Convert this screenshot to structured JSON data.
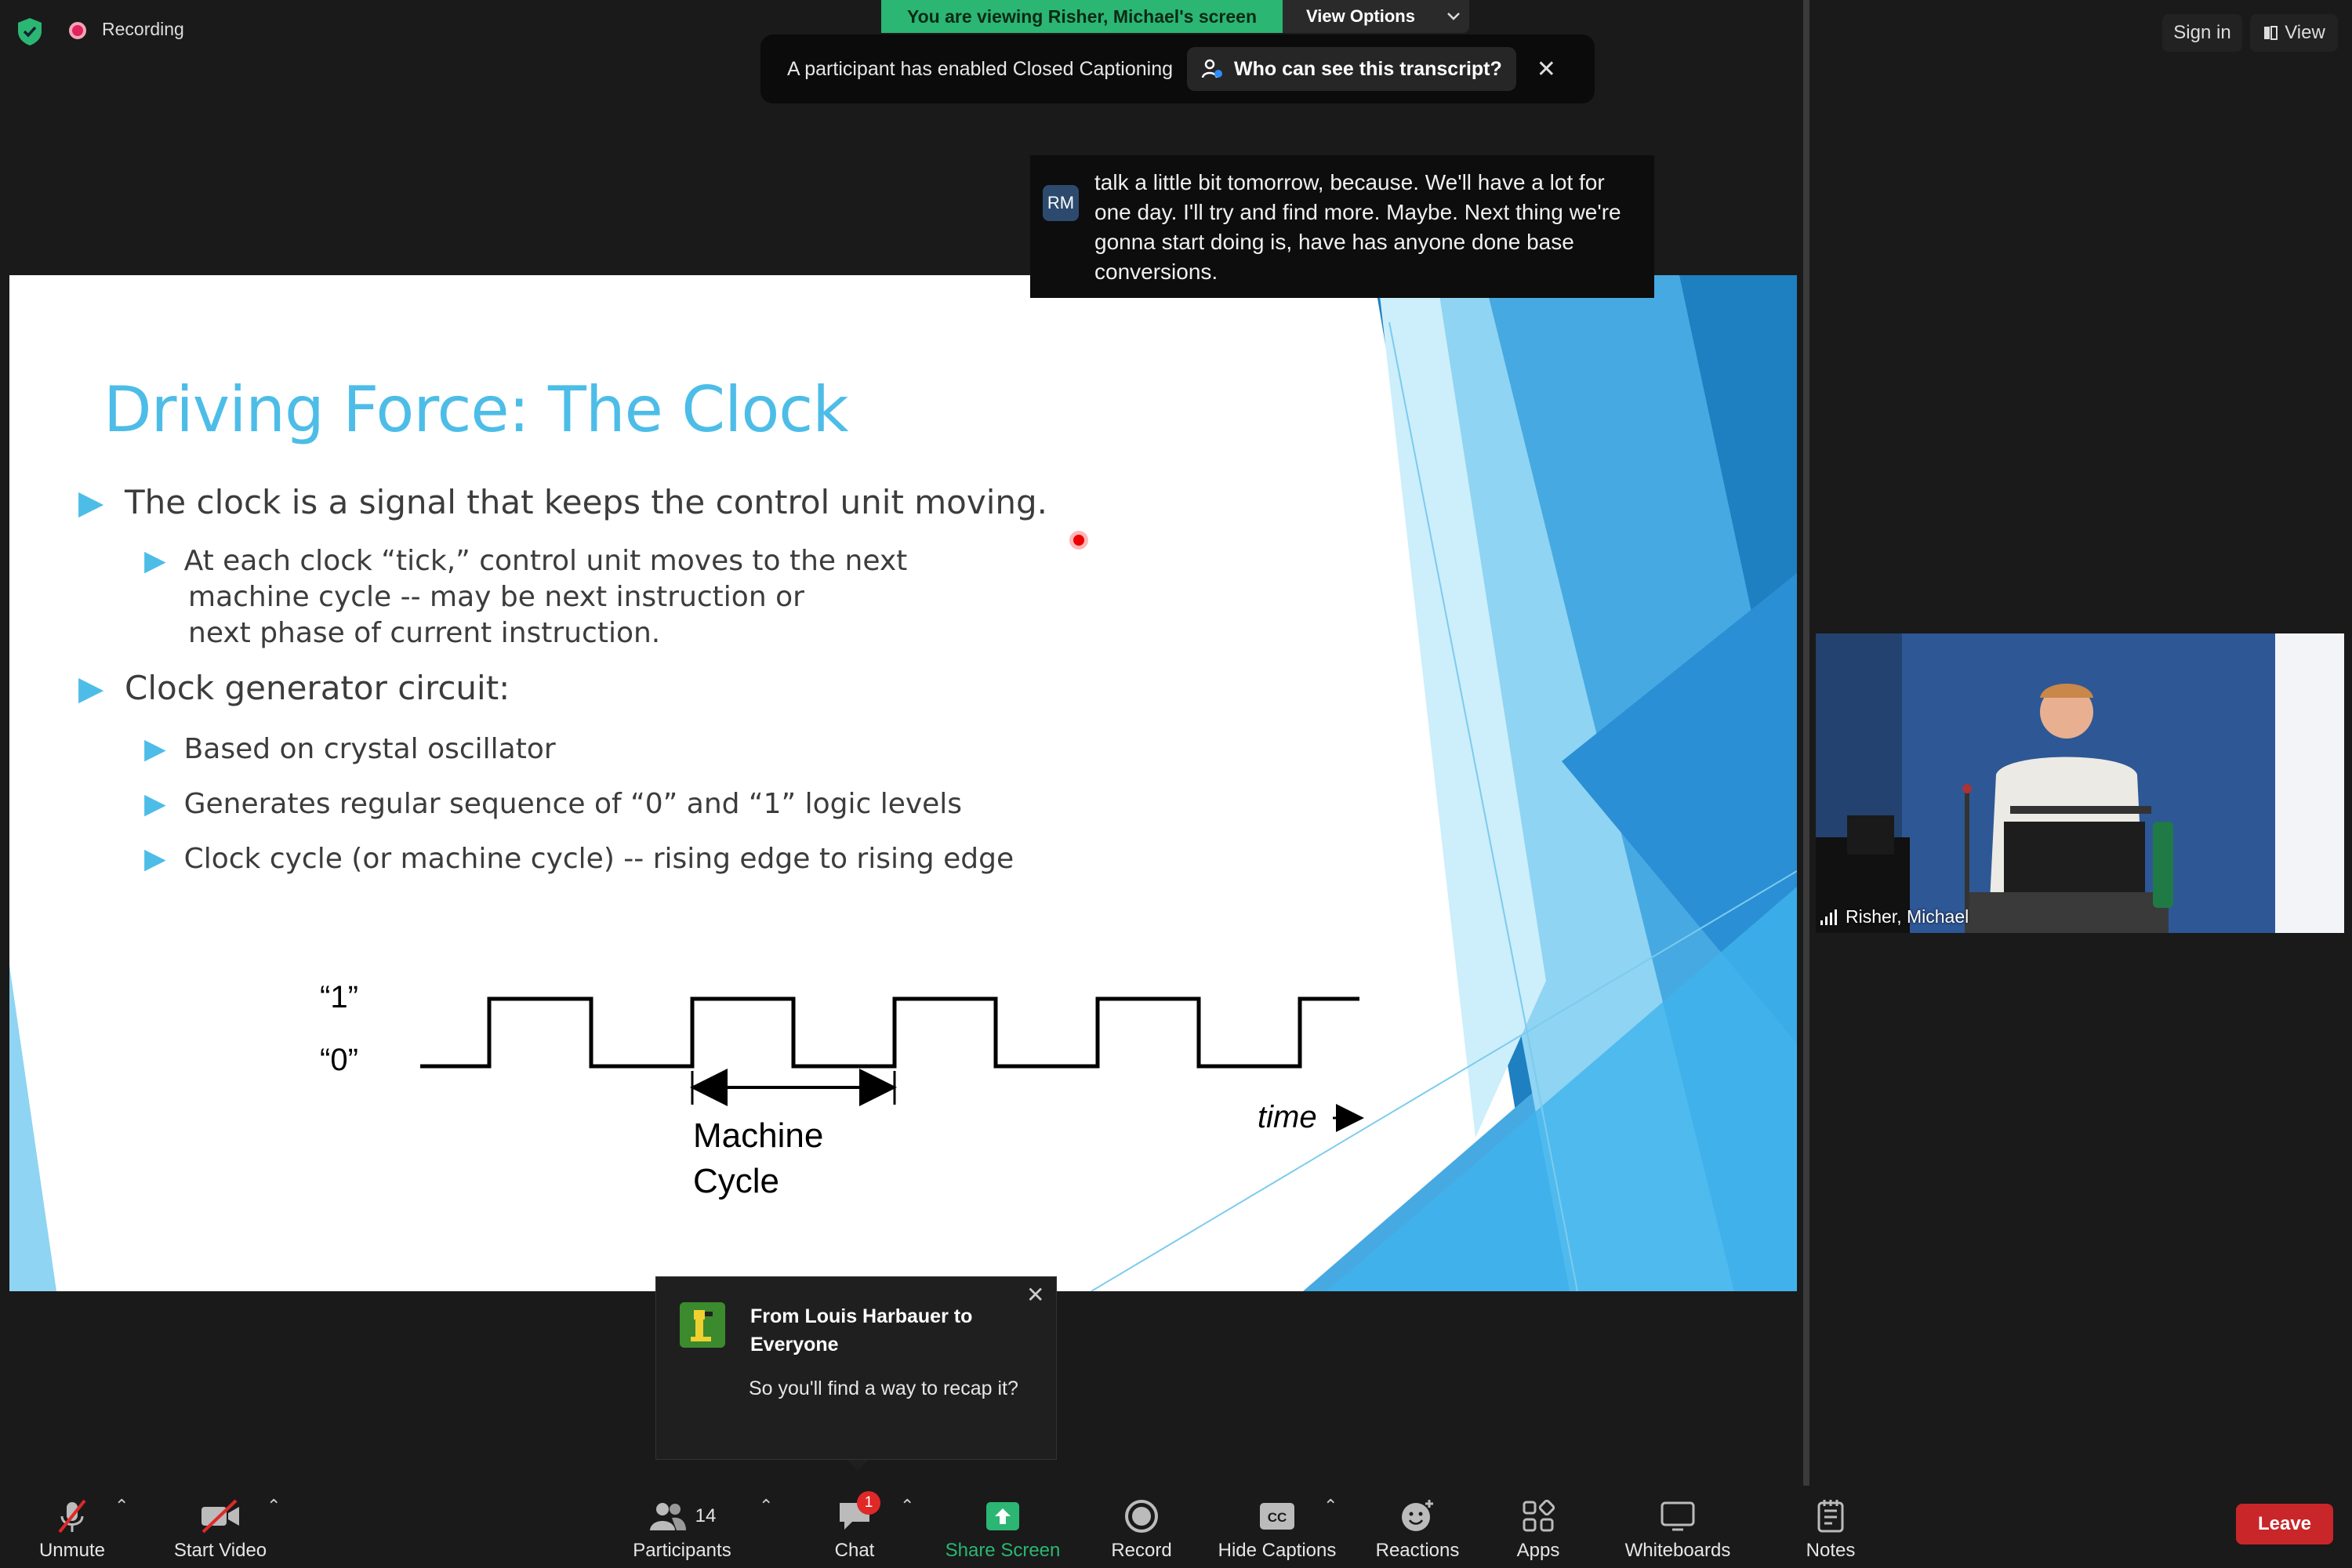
{
  "top_bar": {
    "recording_label": "Recording",
    "viewing_banner": "You are viewing Risher, Michael's screen",
    "view_options_label": "View Options",
    "sign_in_label": "Sign in",
    "view_label": "View"
  },
  "cc_banner": {
    "text": "A participant has enabled Closed Captioning",
    "transcript_button": "Who can see this transcript?"
  },
  "caption": {
    "avatar_initials": "RM",
    "text": "talk a little bit tomorrow, because. We'll have a lot for one day. I'll try and find more. Maybe. Next thing we're gonna start doing is, have has anyone done base conversions."
  },
  "slide": {
    "title": "Driving Force: The Clock",
    "bullets": [
      "The clock is a signal that keeps the control unit moving.",
      "At each clock “tick,” control unit moves to the next",
      "machine cycle -- may be next instruction or",
      "next phase of current instruction.",
      "Clock generator circuit:",
      "Based on crystal oscillator",
      "Generates regular sequence of “0” and “1” logic levels",
      "Clock cycle (or machine cycle) -- rising edge to rising edge"
    ],
    "diagram": {
      "label_high": "“1”",
      "label_low": "“0”",
      "machine_label_line1": "Machine",
      "machine_label_line2": "Cycle",
      "time_label": "time"
    }
  },
  "participant_video": {
    "name": "Risher, Michael"
  },
  "chat_toast": {
    "from": "From Louis Harbauer to Everyone",
    "message": "So you'll find a way to recap it?"
  },
  "toolbar": {
    "unmute": "Unmute",
    "start_video": "Start Video",
    "participants": "Participants",
    "participant_count": "14",
    "chat": "Chat",
    "chat_badge": "1",
    "share_screen": "Share Screen",
    "record": "Record",
    "hide_captions": "Hide Captions",
    "reactions": "Reactions",
    "apps": "Apps",
    "whiteboards": "Whiteboards",
    "notes": "Notes",
    "leave": "Leave"
  },
  "colors": {
    "share_green": "#2bb673",
    "leave_red": "#c9262a",
    "slide_accent": "#4dbde8"
  }
}
